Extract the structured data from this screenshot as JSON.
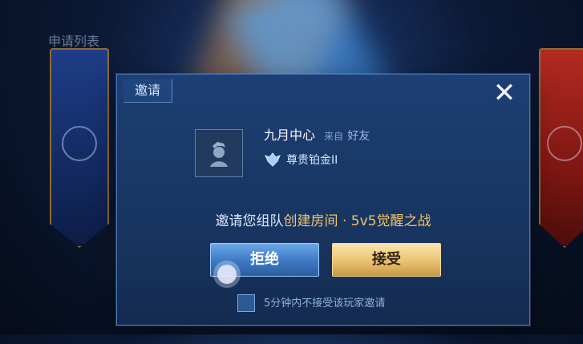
{
  "background": {
    "app_title": "申请列表"
  },
  "dialog": {
    "title": "邀请",
    "close_glyph": "✕",
    "player": {
      "name": "九月中心",
      "from_label": "来自",
      "friend_label": "好友",
      "rank": "尊贵铂金II",
      "avatar_icon": "player-avatar-icon",
      "rank_icon": "rank-emblem-icon"
    },
    "invite_text": {
      "prefix": "邀请您组队",
      "mode": "创建房间 · 5v5觉醒之战"
    },
    "buttons": {
      "reject": "拒绝",
      "accept": "接受"
    },
    "checkbox_label": "5分钟内不接受该玩家邀请"
  },
  "colors": {
    "accent_gold": "#f2c36a",
    "reject_blue": "#3d78c2",
    "accept_gold": "#e8bf6e",
    "dialog_bg": "#183561"
  }
}
